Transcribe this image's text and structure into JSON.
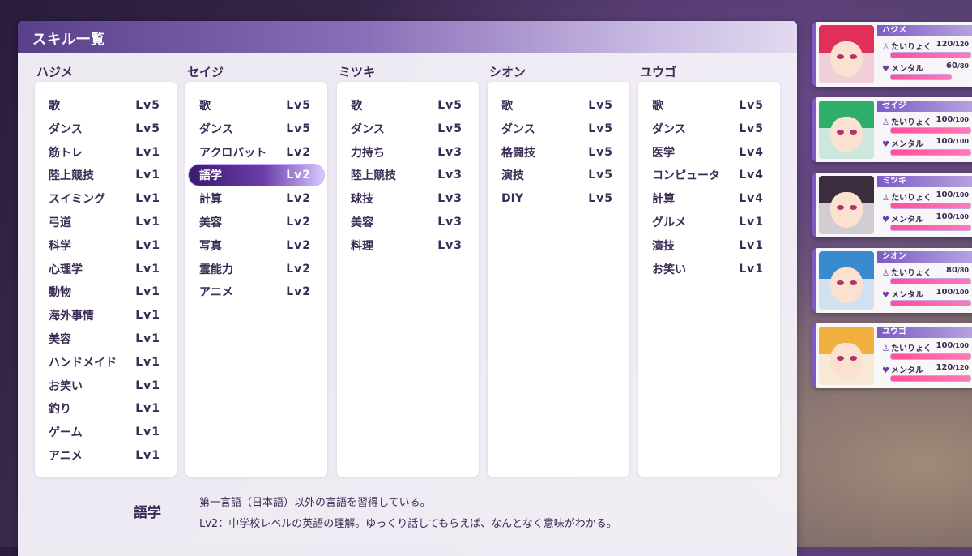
{
  "panel": {
    "title": "スキル一覧"
  },
  "columns": [
    {
      "name": "ハジメ",
      "skills": [
        {
          "name": "歌",
          "lv": "Lv5"
        },
        {
          "name": "ダンス",
          "lv": "Lv5"
        },
        {
          "name": "筋トレ",
          "lv": "Lv1"
        },
        {
          "name": "陸上競技",
          "lv": "Lv1"
        },
        {
          "name": "スイミング",
          "lv": "Lv1"
        },
        {
          "name": "弓道",
          "lv": "Lv1"
        },
        {
          "name": "科学",
          "lv": "Lv1"
        },
        {
          "name": "心理学",
          "lv": "Lv1"
        },
        {
          "name": "動物",
          "lv": "Lv1"
        },
        {
          "name": "海外事情",
          "lv": "Lv1"
        },
        {
          "name": "美容",
          "lv": "Lv1"
        },
        {
          "name": "ハンドメイド",
          "lv": "Lv1"
        },
        {
          "name": "お笑い",
          "lv": "Lv1"
        },
        {
          "name": "釣り",
          "lv": "Lv1"
        },
        {
          "name": "ゲーム",
          "lv": "Lv1"
        },
        {
          "name": "アニメ",
          "lv": "Lv1"
        }
      ]
    },
    {
      "name": "セイジ",
      "skills": [
        {
          "name": "歌",
          "lv": "Lv5"
        },
        {
          "name": "ダンス",
          "lv": "Lv5"
        },
        {
          "name": "アクロバット",
          "lv": "Lv2"
        },
        {
          "name": "語学",
          "lv": "Lv2",
          "selected": true
        },
        {
          "name": "計算",
          "lv": "Lv2"
        },
        {
          "name": "美容",
          "lv": "Lv2"
        },
        {
          "name": "写真",
          "lv": "Lv2"
        },
        {
          "name": "霊能力",
          "lv": "Lv2"
        },
        {
          "name": "アニメ",
          "lv": "Lv2"
        }
      ]
    },
    {
      "name": "ミツキ",
      "skills": [
        {
          "name": "歌",
          "lv": "Lv5"
        },
        {
          "name": "ダンス",
          "lv": "Lv5"
        },
        {
          "name": "力持ち",
          "lv": "Lv3"
        },
        {
          "name": "陸上競技",
          "lv": "Lv3"
        },
        {
          "name": "球技",
          "lv": "Lv3"
        },
        {
          "name": "美容",
          "lv": "Lv3"
        },
        {
          "name": "料理",
          "lv": "Lv3"
        }
      ]
    },
    {
      "name": "シオン",
      "skills": [
        {
          "name": "歌",
          "lv": "Lv5"
        },
        {
          "name": "ダンス",
          "lv": "Lv5"
        },
        {
          "name": "格闘技",
          "lv": "Lv5"
        },
        {
          "name": "演技",
          "lv": "Lv5"
        },
        {
          "name": "DIY",
          "lv": "Lv5"
        }
      ]
    },
    {
      "name": "ユウゴ",
      "skills": [
        {
          "name": "歌",
          "lv": "Lv5"
        },
        {
          "name": "ダンス",
          "lv": "Lv5"
        },
        {
          "name": "医学",
          "lv": "Lv4"
        },
        {
          "name": "コンピュータ",
          "lv": "Lv4"
        },
        {
          "name": "計算",
          "lv": "Lv4"
        },
        {
          "name": "グルメ",
          "lv": "Lv1"
        },
        {
          "name": "演技",
          "lv": "Lv1"
        },
        {
          "name": "お笑い",
          "lv": "Lv1"
        }
      ]
    }
  ],
  "description": {
    "skill_name": "語学",
    "line1": "第一言語（日本語）以外の言語を習得している。",
    "line2": "Lv2：中学校レベルの英語の理解。ゆっくり話してもらえば、なんとなく意味がわかる。"
  },
  "characters": [
    {
      "name": "ハジメ",
      "stamina_label": "たいりょく",
      "stamina": "120",
      "stamina_max": "/120",
      "stamina_pct": 100,
      "mental_label": "メンタル",
      "mental": "60",
      "mental_max": "/80",
      "mental_pct": 75,
      "hair": "#e0305a"
    },
    {
      "name": "セイジ",
      "stamina_label": "たいりょく",
      "stamina": "100",
      "stamina_max": "/100",
      "stamina_pct": 100,
      "mental_label": "メンタル",
      "mental": "100",
      "mental_max": "/100",
      "mental_pct": 100,
      "hair": "#2fae6a"
    },
    {
      "name": "ミツキ",
      "stamina_label": "たいりょく",
      "stamina": "100",
      "stamina_max": "/100",
      "stamina_pct": 100,
      "mental_label": "メンタル",
      "mental": "100",
      "mental_max": "/100",
      "mental_pct": 100,
      "hair": "#3a2d3e"
    },
    {
      "name": "シオン",
      "stamina_label": "たいりょく",
      "stamina": "80",
      "stamina_max": "/80",
      "stamina_pct": 100,
      "mental_label": "メンタル",
      "mental": "100",
      "mental_max": "/100",
      "mental_pct": 100,
      "hair": "#3a8ad0"
    },
    {
      "name": "ユウゴ",
      "stamina_label": "たいりょく",
      "stamina": "100",
      "stamina_max": "/100",
      "stamina_pct": 100,
      "mental_label": "メンタル",
      "mental": "120",
      "mental_max": "/120",
      "mental_pct": 100,
      "hair": "#f2b040"
    }
  ]
}
